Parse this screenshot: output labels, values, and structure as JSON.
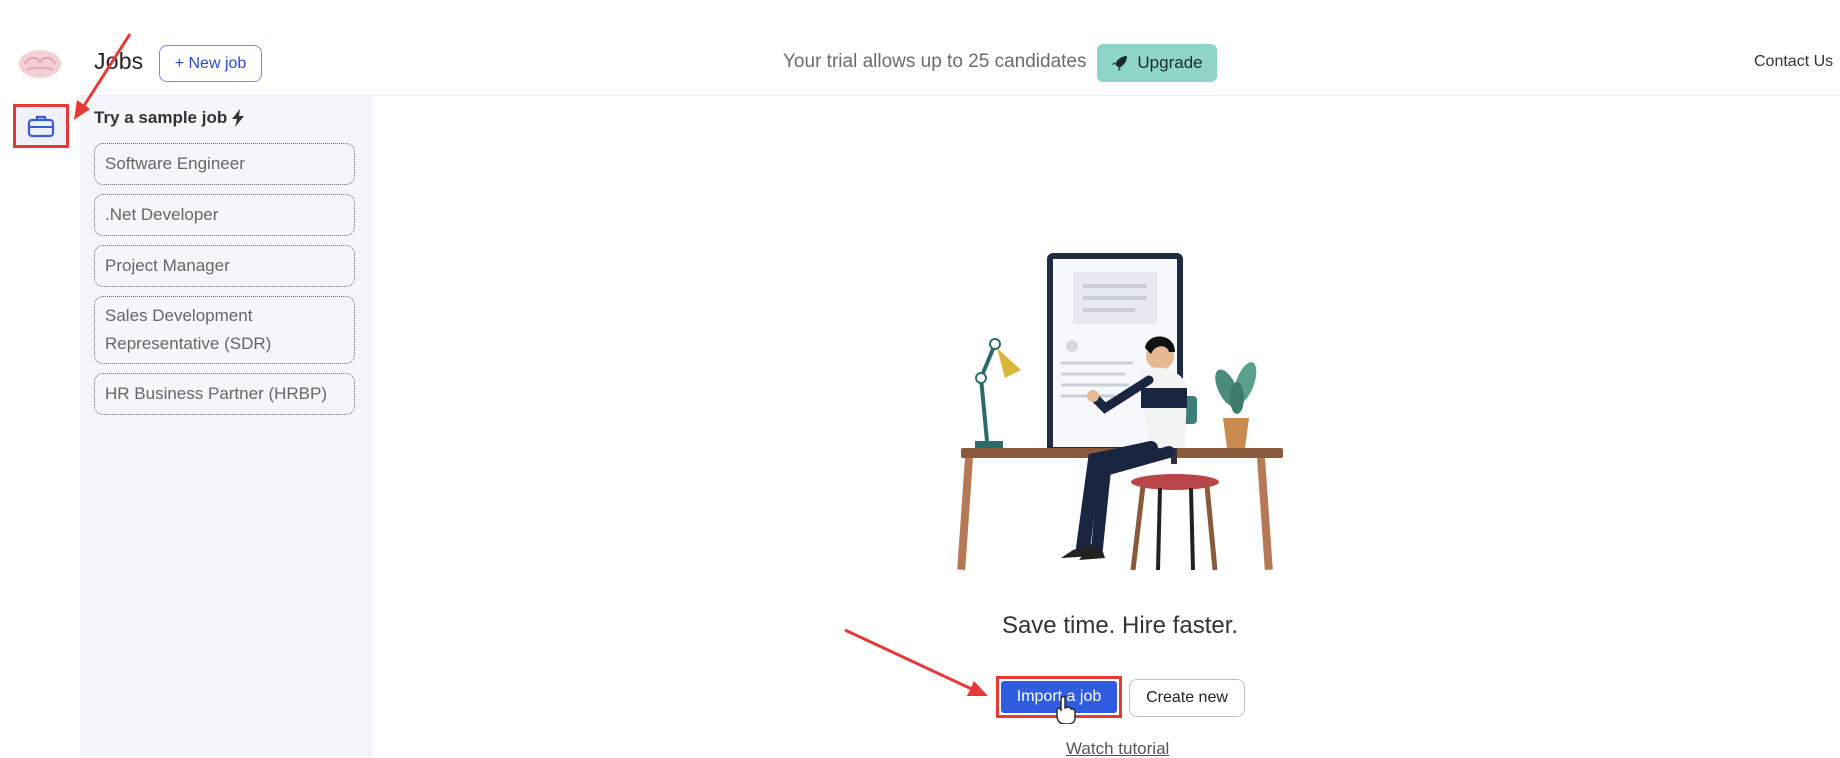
{
  "header": {
    "title": "Jobs",
    "new_job_label": "+ New job",
    "trial_text": "Your trial allows up to 25 candidates",
    "upgrade_label": "Upgrade",
    "contact_label": "Contact Us"
  },
  "sidebar": {
    "section_title": "Try a sample job",
    "sample_jobs": [
      "Software Engineer",
      ".Net Developer",
      "Project Manager",
      "Sales Development Representative (SDR)",
      "HR Business Partner (HRBP)"
    ]
  },
  "main": {
    "tagline": "Save time. Hire faster.",
    "import_label": "Import a job",
    "create_label": "Create new",
    "watch_label": "Watch tutorial"
  },
  "icons": {
    "logo": "brain-logo-icon",
    "jobs_nav": "briefcase-icon",
    "lightning": "lightning-icon",
    "rocket": "rocket-icon",
    "cursor": "hand-cursor-icon"
  },
  "colors": {
    "primary": "#2f5ce0",
    "upgrade_bg": "#8fd4c8",
    "annotation": "#e53935",
    "sidebar_bg": "#f4f6fb"
  }
}
